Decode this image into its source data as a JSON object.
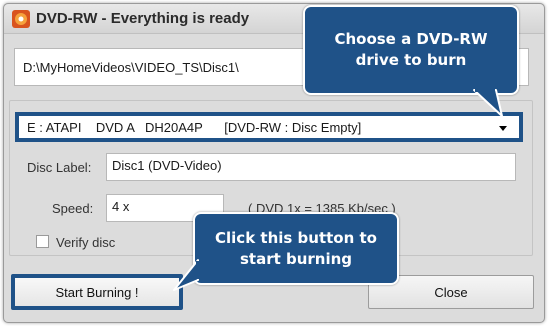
{
  "window": {
    "title": "DVD-RW - Everything is ready"
  },
  "source": {
    "path": "D:\\MyHomeVideos\\VIDEO_TS\\Disc1\\"
  },
  "drive": {
    "selected": "E : ATAPI    DVD A   DH20A4P      [DVD-RW : Disc Empty]"
  },
  "disc_label": {
    "label": "Disc Label:",
    "value": "Disc1 (DVD-Video)"
  },
  "speed": {
    "label": "Speed:",
    "value": "4 x",
    "info": "( DVD 1x  =  1385 Kb/sec )"
  },
  "verify": {
    "label": "Verify disc",
    "checked": false
  },
  "buttons": {
    "start": "Start Burning !",
    "close": "Close"
  },
  "callouts": {
    "drive": "Choose a DVD-RW drive to burn",
    "start": "Click this button to start burning"
  },
  "colors": {
    "highlight": "#1f5288",
    "window_bg": "#dcdcdc"
  }
}
